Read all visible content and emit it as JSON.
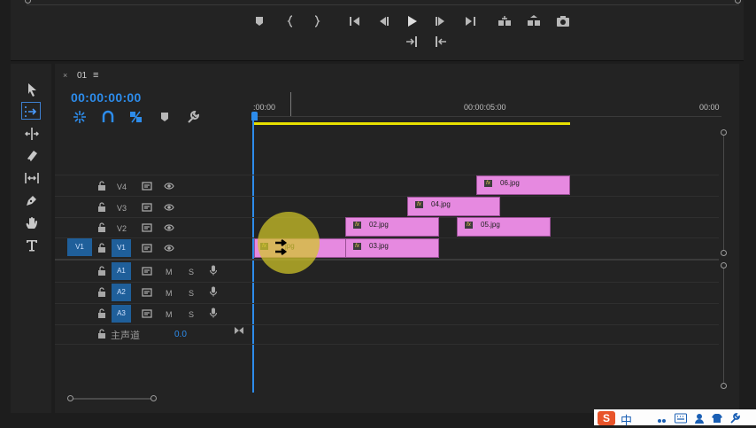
{
  "sequence": {
    "name": "01",
    "close_glyph": "×",
    "menu_glyph": "≡"
  },
  "timecode": "00:00:00:00",
  "ruler": {
    "labels": [
      ":00:00",
      "00:00:05:00",
      "00:00"
    ]
  },
  "colors": {
    "accent": "#2d8ceb",
    "clip": "#e689e0",
    "work_area": "#e8e000",
    "track_target": "#1f5f9a"
  },
  "transport_icons": [
    "marker-icon",
    "mark-in-icon",
    "mark-out-icon",
    "go-to-in-icon",
    "step-back-icon",
    "play-icon",
    "step-forward-icon",
    "go-to-out-icon",
    "lift-icon",
    "extract-icon",
    "export-frame-icon",
    "insert-icon",
    "overwrite-icon"
  ],
  "timeline_tools": [
    "snap-icon",
    "linked-selection-icon",
    "add-marker-icon",
    "timeline-settings-icon"
  ],
  "tools": [
    "selection-tool",
    "track-select-tool",
    "ripple-edit-tool",
    "razor-tool",
    "slip-tool",
    "pen-tool",
    "hand-tool",
    "type-tool"
  ],
  "video_tracks": [
    {
      "id": "V4",
      "source": ""
    },
    {
      "id": "V3",
      "source": ""
    },
    {
      "id": "V2",
      "source": ""
    },
    {
      "id": "V1",
      "source": "V1"
    }
  ],
  "audio_tracks": [
    {
      "id": "A1",
      "mute": "M",
      "solo": "S"
    },
    {
      "id": "A2",
      "mute": "M",
      "solo": "S"
    },
    {
      "id": "A3",
      "mute": "M",
      "solo": "S"
    }
  ],
  "master": {
    "label": "主声道",
    "value": "0.0"
  },
  "clips": [
    {
      "track": "V1",
      "name": "jpg",
      "label": "01.jpg"
    },
    {
      "track": "V1",
      "name": "03.jpg",
      "label": "03.jpg"
    },
    {
      "track": "V2",
      "name": "02.jpg",
      "label": "02.jpg"
    },
    {
      "track": "V2",
      "name": "05.jpg",
      "label": "05.jpg"
    },
    {
      "track": "V3",
      "name": "04.jpg",
      "label": "04.jpg"
    },
    {
      "track": "V4",
      "name": "06.jpg",
      "label": "06.jpg"
    }
  ],
  "ime_bar": {
    "logo": "S",
    "chinese": "中"
  }
}
